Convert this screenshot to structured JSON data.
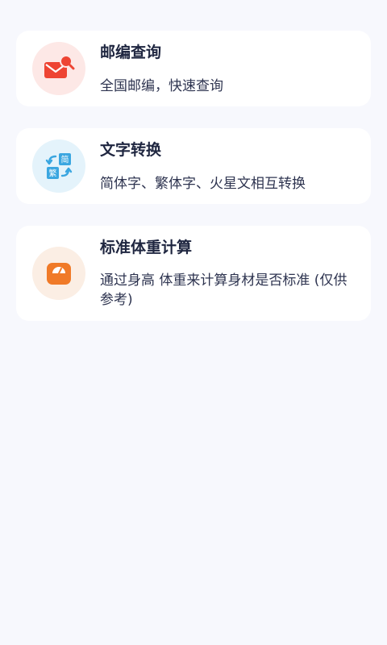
{
  "cards": [
    {
      "title": "邮编查询",
      "description": "全国邮编，快速查询",
      "icon": "mail-search-icon",
      "icon_color": "#ee4433",
      "icon_bg": "#fde8e6"
    },
    {
      "title": "文字转换",
      "description": "简体字、繁体字、火星文相互转换",
      "icon": "convert-icon",
      "icon_color": "#3aa6e0",
      "icon_bg": "#e4f3fb",
      "icon_glyphs": {
        "simplified": "简",
        "traditional": "繁"
      }
    },
    {
      "title": "标准体重计算",
      "description": "通过身高 体重来计算身材是否标准 (仅供参考)",
      "icon": "scale-icon",
      "icon_color": "#f07a28",
      "icon_bg": "#fbeee4"
    }
  ]
}
